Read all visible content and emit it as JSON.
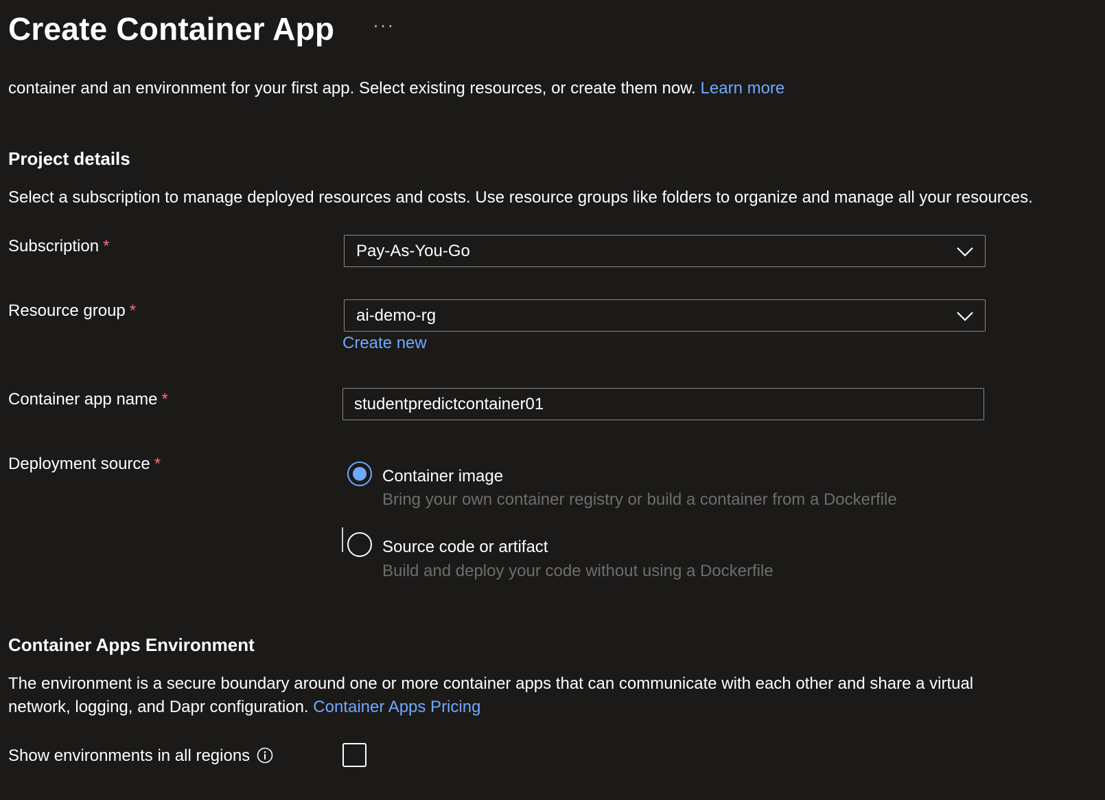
{
  "header": {
    "title": "Create Container App",
    "more_label": "···"
  },
  "intro": {
    "text": "container and an environment for your first app. Select existing resources, or create them now.",
    "link": "Learn more"
  },
  "project_details": {
    "heading": "Project details",
    "description": "Select a subscription to manage deployed resources and costs. Use resource groups like folders to organize and manage all your resources.",
    "subscription": {
      "label": "Subscription",
      "required": "*",
      "value": "Pay-As-You-Go"
    },
    "resource_group": {
      "label": "Resource group",
      "required": "*",
      "value": "ai-demo-rg",
      "create_new": "Create new"
    },
    "app_name": {
      "label": "Container app name",
      "required": "*",
      "value": "studentpredictcontainer01"
    },
    "deployment_source": {
      "label": "Deployment source",
      "required": "*",
      "options": [
        {
          "label": "Container image",
          "description": "Bring your own container registry or build a container from a Dockerfile",
          "selected": true
        },
        {
          "label": "Source code or artifact",
          "description": "Build and deploy your code without using a Dockerfile",
          "selected": false
        }
      ]
    }
  },
  "environment": {
    "heading": "Container Apps Environment",
    "description_line1": "The environment is a secure boundary around one or more container apps that can communicate with each other and share a virtual",
    "description_line2": "network, logging, and Dapr configuration.",
    "pricing_link": "Container Apps Pricing",
    "show_all_regions": {
      "label": "Show environments in all regions",
      "checked": false
    }
  },
  "colors": {
    "background": "#1b1a19",
    "link": "#6fa9ff",
    "required": "#f1707b",
    "muted": "#6e6d6b",
    "border": "#8a8886"
  },
  "icons": {
    "more": "ellipsis-icon",
    "dropdown": "chevron-down-icon",
    "info": "info-icon"
  }
}
